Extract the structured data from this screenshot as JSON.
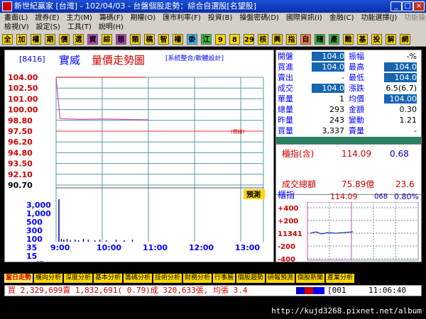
{
  "window": {
    "title": "新世紀贏家 [台灣] - 102/04/03 - 台盤個股走勢：綜合自選股[名望股]"
  },
  "menu1": [
    "畫面(L)",
    "證券(E)",
    "主力(M)",
    "籌碼(F)",
    "期權(O)",
    "匯市利率(F)",
    "投資(B)",
    "操盤密碼(D)",
    "國際資訊(I)",
    "金融(C)",
    "功能選擇(J)",
    "功能操作"
  ],
  "menu2": [
    "檢視(V)",
    "設定(S)",
    "工具(T)",
    "說明(H)"
  ],
  "toolbar": [
    "全",
    "加",
    "權",
    "期",
    "價",
    "選",
    "資",
    "綜",
    "態",
    "類",
    "稿",
    "智",
    "權",
    "委",
    "江",
    "9",
    "8",
    "29",
    "核",
    "興",
    "指",
    "自",
    "隨",
    "產",
    "難",
    "基",
    "投",
    "解",
    "網"
  ],
  "chart": {
    "code": "[8416]",
    "name": "實威",
    "title": "量價走勢圖",
    "note": "[系統整合/軟體設計]",
    "price_ticks": [
      "104.00",
      "102.50",
      "101.00",
      "100.00",
      "98.80",
      "97.50",
      "96.20",
      "94.80",
      "93.50",
      "92.10",
      "90.70"
    ],
    "ref_label": "(標線)",
    "forecast_label": "預測",
    "volume_ticks": [
      "3,000",
      "1,000",
      "500",
      "300",
      "100",
      "35",
      "15"
    ],
    "volume_unit": "張",
    "time_ticks": [
      "9:00",
      "10:00",
      "11:00",
      "12:00",
      "13:00"
    ],
    "chart_data": {
      "type": "line",
      "title": "量價走勢圖",
      "xlabel": "",
      "ylabel": "",
      "x": [
        "9:00",
        "9:05",
        "9:30",
        "10:00",
        "10:30",
        "11:00"
      ],
      "series": [
        {
          "values": [
            104.0,
            98.9,
            98.8,
            98.85,
            98.8,
            98.75
          ]
        }
      ],
      "ylim": [
        90.7,
        104.0
      ]
    }
  },
  "quote": {
    "rows": [
      {
        "l1": "開盤",
        "v1": "104.0",
        "l2": "振幅",
        "v2": "-%",
        "hl1": true
      },
      {
        "l1": "買進",
        "v1": "104.0",
        "l2": "最高",
        "v2": "104.0",
        "hl1": true,
        "hl2": true
      },
      {
        "l1": "賣出",
        "v1": "-",
        "l2": "最低",
        "v2": "104.0",
        "hl2": true
      },
      {
        "l1": "成交",
        "v1": "104.0",
        "l2": "漲跌",
        "v2": "6.5(6.7)",
        "hl1": true
      },
      {
        "l1": "單量",
        "v1": "1",
        "l2": "均價",
        "v2": "104.00",
        "hl2": true
      },
      {
        "l1": "總量",
        "v1": "293",
        "l2": "金額",
        "v2": "0.30"
      },
      {
        "l1": "昨量",
        "v1": "243",
        "l2": "變動",
        "v2": "1.21"
      },
      {
        "l1": "買量",
        "v1": "3,337",
        "l2": "賣量",
        "v2": "-"
      }
    ],
    "index_label": "櫃指(含)",
    "index_value": "114.09",
    "index_change": "0.68",
    "turnover_label": "成交總額",
    "turnover_value": "75.89億",
    "turnover_extra": "23.6",
    "mini_title": "櫃指",
    "mini_value": "114.09",
    "mini_vol": "068",
    "mini_pct": "0.80%",
    "mini_ticks": [
      "+400",
      "+200",
      "11341",
      "-200",
      "-400"
    ]
  },
  "tabs": [
    "當日走勢",
    "橫向分析",
    "深度分析",
    "基本分析",
    "籌碼分析",
    "技術分析",
    "財務分析",
    "行事曆",
    "個股趨勢",
    "研報預測",
    "個股新聞",
    "產業分析"
  ],
  "status": {
    "text": "買 2,329,699賣 1,832,691( 0.79)成 320,633張, 均張 3.4",
    "code": "[001",
    "time": "11:06:40"
  },
  "url": "http://kujd3268.pixnet.net/album",
  "colors": {
    "price_line": "#c050c0",
    "grid": "#5a9aa0",
    "axis": "#00f",
    "accent": "#1565b0"
  }
}
